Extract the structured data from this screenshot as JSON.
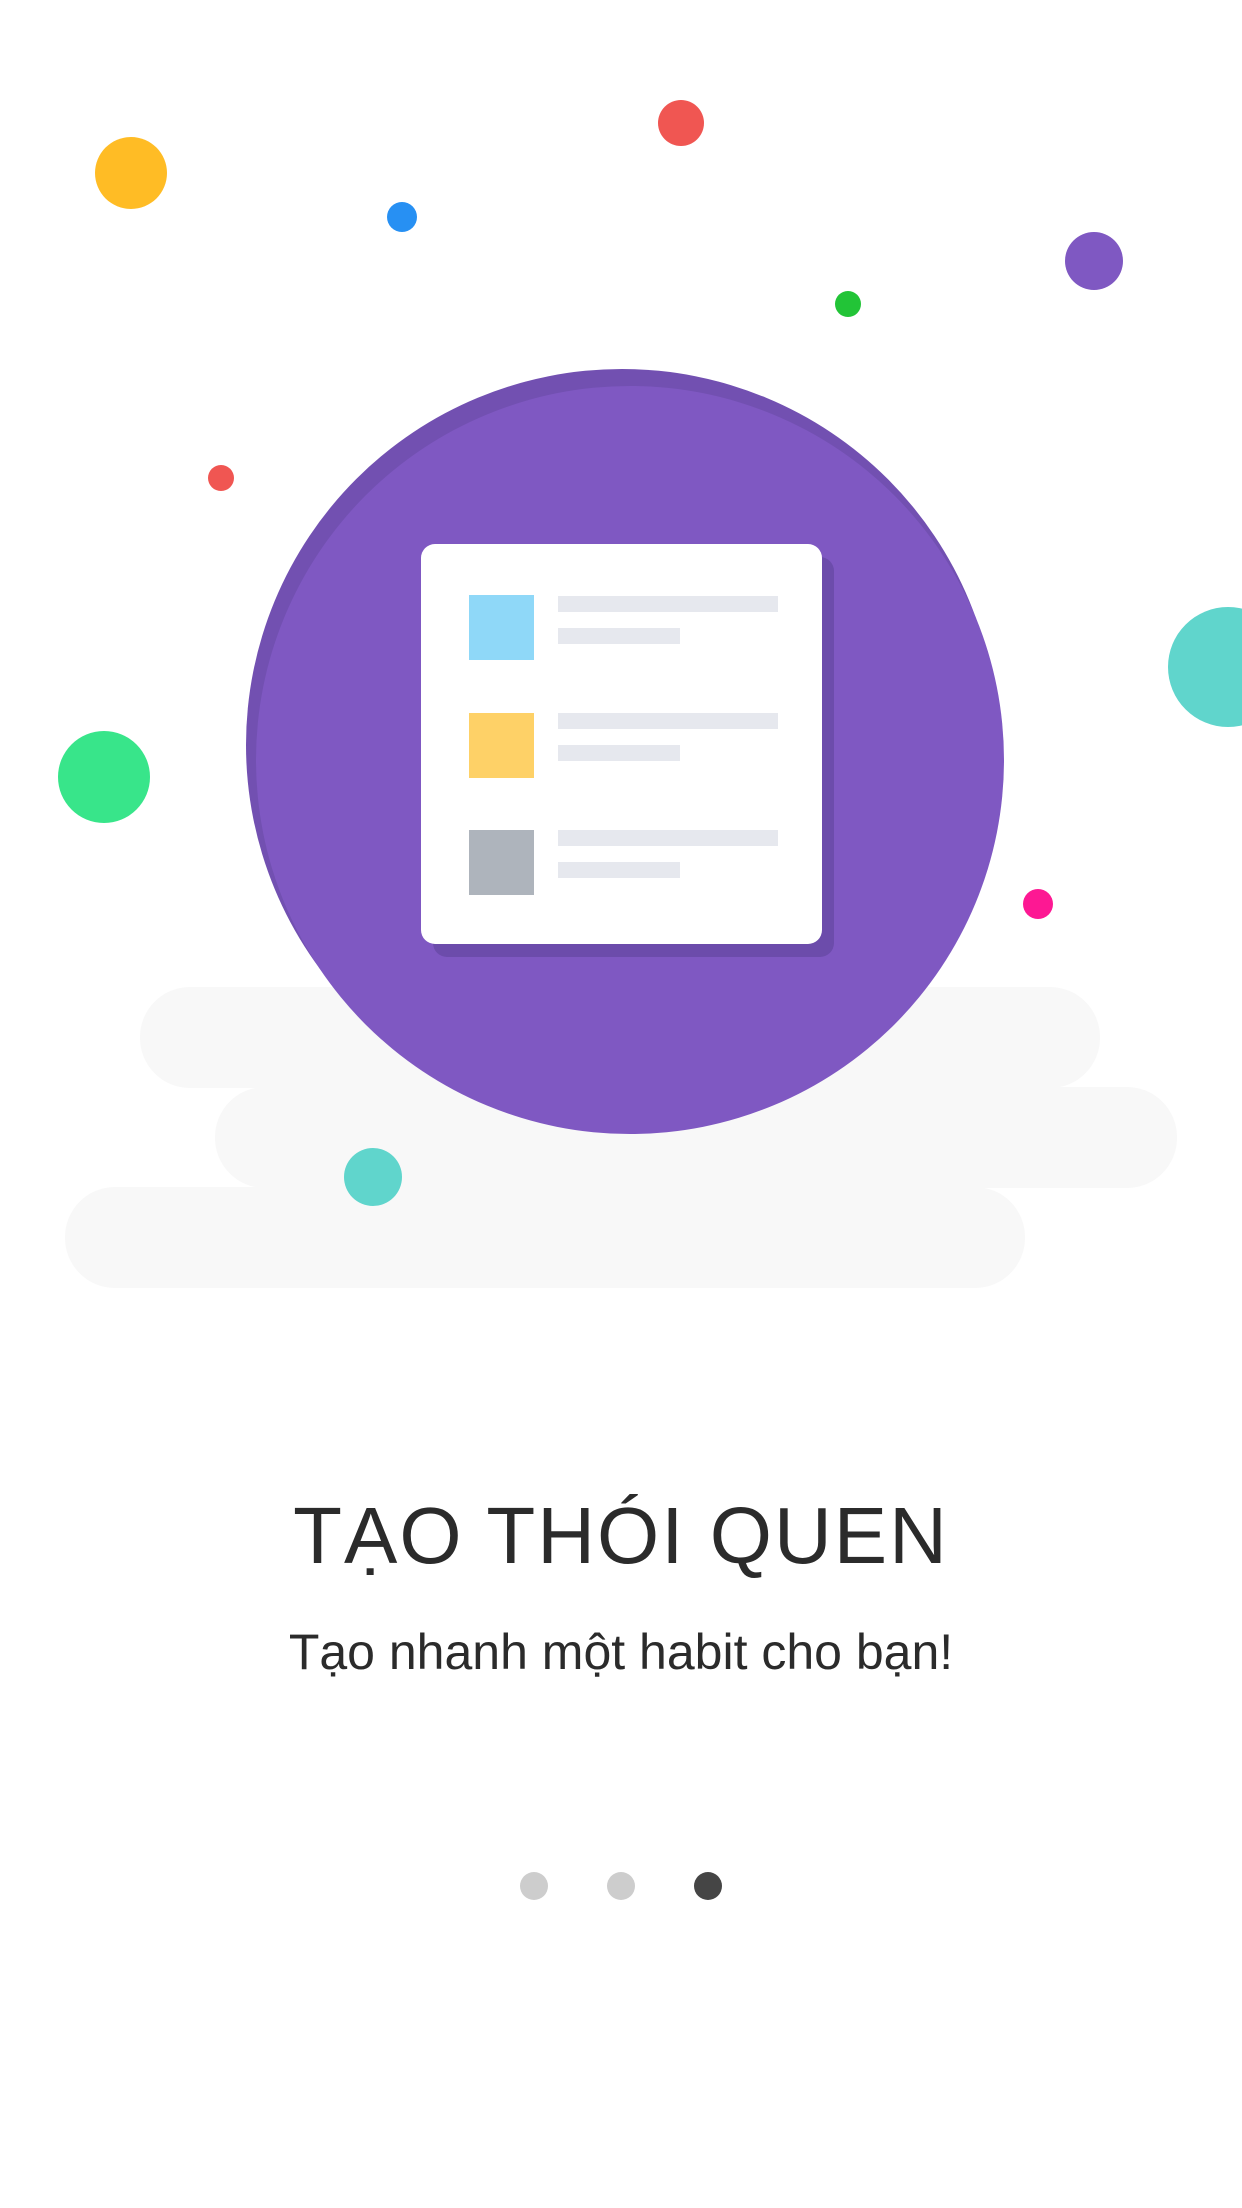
{
  "onboarding": {
    "title": "TẠO THÓI QUEN",
    "subtitle": "Tạo nhanh một habit cho bạn!"
  },
  "pager": {
    "page_count": 3,
    "current_page": 3
  },
  "colors": {
    "background": "#ffffff",
    "circle_primary": "#7f58c2",
    "circle_shadow": "#7250b1",
    "cloud": "#f8f8f8",
    "card": "#ffffff",
    "card_line": "#e6e8ee",
    "item_1": "#8fd8f8",
    "item_2": "#fed167",
    "item_3": "#aeb4bc",
    "dot_inactive": "#cdcdcd",
    "dot_active": "#454545"
  },
  "icons": {
    "illustration": "checklist-document-icon"
  }
}
